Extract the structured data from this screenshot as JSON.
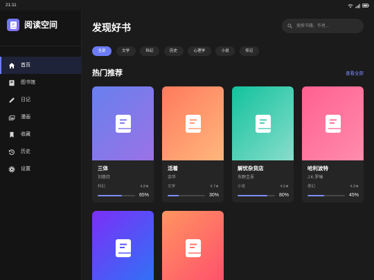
{
  "status_bar": {
    "time": "21:11",
    "icons": [
      "wifi-icon",
      "signal-icon",
      "battery-icon"
    ]
  },
  "app": {
    "name": "阅读空间",
    "logo_icon": "book-icon"
  },
  "sidebar": {
    "items": [
      {
        "label": "首页",
        "icon": "home-icon",
        "active": true
      },
      {
        "label": "图书馆",
        "icon": "library-icon",
        "active": false
      },
      {
        "label": "日记",
        "icon": "pen-icon",
        "active": false
      },
      {
        "label": "漫画",
        "icon": "images-icon",
        "active": false
      },
      {
        "label": "收藏",
        "icon": "bookmark-icon",
        "active": false
      },
      {
        "label": "历史",
        "icon": "history-icon",
        "active": false
      },
      {
        "label": "设置",
        "icon": "gear-icon",
        "active": false
      }
    ]
  },
  "header": {
    "title": "发现好书",
    "search_placeholder": "搜索书籍、作者...",
    "search_icon": "search-icon"
  },
  "filters": {
    "items": [
      "全部",
      "文学",
      "科幻",
      "历史",
      "心理学",
      "小说",
      "传记"
    ],
    "active_index": 0
  },
  "section": {
    "title": "热门推荐",
    "view_all": "查看全部"
  },
  "books": [
    {
      "title": "三体",
      "author": "刘慈欣",
      "genre": "科幻",
      "rating": "4.8★",
      "progress": 65,
      "progress_label": "65%",
      "cover_icon": "book-icon",
      "cover_colors": [
        "#6880ee",
        "#9a72e6"
      ]
    },
    {
      "title": "活着",
      "author": "余华",
      "genre": "文学",
      "rating": "4.7★",
      "progress": 30,
      "progress_label": "30%",
      "cover_icon": "book-icon",
      "cover_colors": [
        "#ff7a5c",
        "#ffb77d"
      ]
    },
    {
      "title": "解忧杂货店",
      "author": "东野圭吾",
      "genre": "小说",
      "rating": "4.6★",
      "progress": 80,
      "progress_label": "80%",
      "cover_icon": "book-icon",
      "cover_colors": [
        "#12c29c",
        "#88ddcc"
      ]
    },
    {
      "title": "哈利波特",
      "author": "J.K.罗琳",
      "genre": "奇幻",
      "rating": "4.9★",
      "progress": 45,
      "progress_label": "45%",
      "cover_icon": "book-icon",
      "cover_colors": [
        "#ff6090",
        "#ff8cab"
      ]
    },
    {
      "cover_icon": "book-icon",
      "cover_colors": [
        "#7b2ff7",
        "#2f74f6"
      ]
    },
    {
      "cover_icon": "book-icon",
      "cover_colors": [
        "#ff9560",
        "#ff4f6c"
      ]
    }
  ],
  "theme": {
    "accent": "#6b7cf5",
    "link": "#7b8cff",
    "progress_fill": "#7f8ef7",
    "progress_track": "#474747",
    "sidebar_bg": "#141414",
    "sidebar_active_bg": "#1f2339",
    "main_bg": "#1b1b1b",
    "card_bg": "#252525",
    "chip_bg": "#2a2a2a",
    "search_bg": "#2b2b2b"
  }
}
